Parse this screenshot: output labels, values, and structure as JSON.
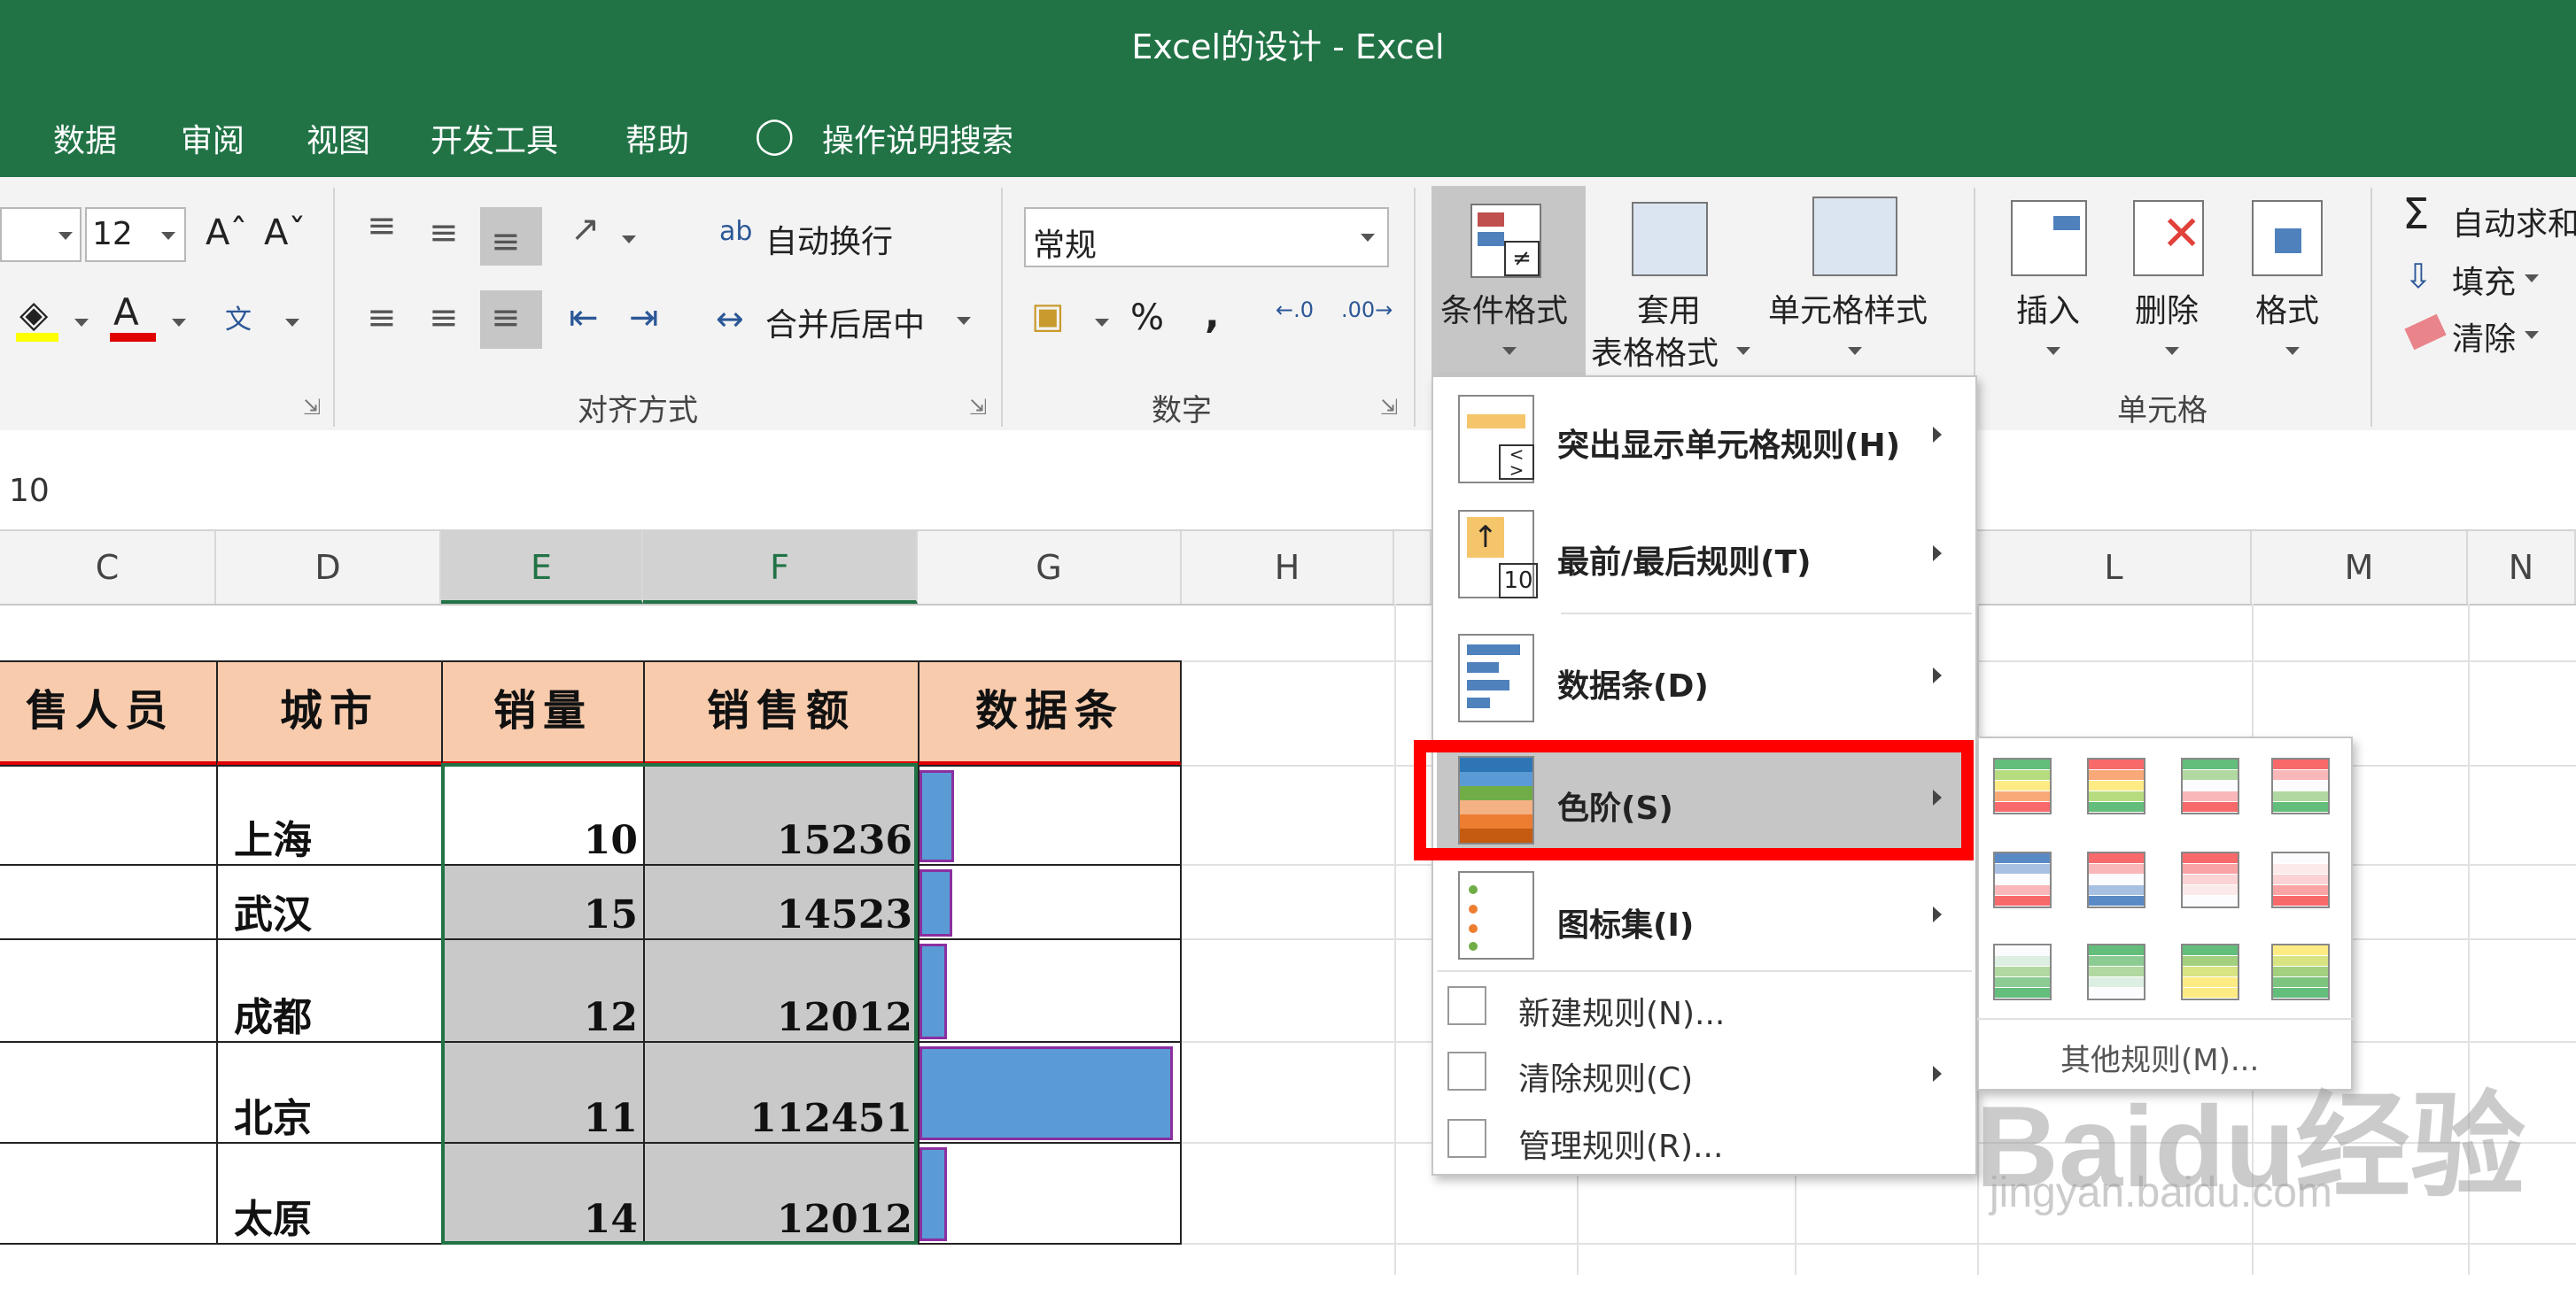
{
  "window": {
    "title": "Excel的设计  -  Excel",
    "theme_color": "#217346"
  },
  "menu": [
    "数据",
    "审阅",
    "视图",
    "开发工具",
    "帮助"
  ],
  "tell_me": "操作说明搜索",
  "ribbon": {
    "font_size": "12",
    "wrap_text": "自动换行",
    "merge_center": "合并后居中",
    "alignment_group": "对齐方式",
    "number_format": "常规",
    "number_group": "数字",
    "percent": "%",
    "comma": ",",
    "cond_format": "条件格式",
    "table_format_1": "套用",
    "table_format_2": "表格格式",
    "cell_styles": "单元格样式",
    "insert": "插入",
    "delete": "删除",
    "format": "格式",
    "cells_group": "单元格",
    "autosum": "自动求和",
    "fill": "填充",
    "clear": "清除",
    "font_color": "#e00000"
  },
  "formula_bar": {
    "value": "10"
  },
  "columns": [
    "C",
    "D",
    "E",
    "F",
    "G",
    "H",
    "L",
    "M",
    "N"
  ],
  "table": {
    "headers": [
      "售人员",
      "城市",
      "销量",
      "销售额",
      "数据条"
    ],
    "rows": [
      {
        "city": "上海",
        "qty": "10",
        "sales": "15236",
        "bar": 0.135
      },
      {
        "city": "武汉",
        "qty": "15",
        "sales": "14523",
        "bar": 0.129
      },
      {
        "city": "成都",
        "qty": "12",
        "sales": "12012",
        "bar": 0.107
      },
      {
        "city": "北京",
        "qty": "11",
        "sales": "112451",
        "bar": 1.0
      },
      {
        "city": "太原",
        "qty": "14",
        "sales": "12012",
        "bar": 0.107
      }
    ],
    "header_color": "#f8cbad",
    "bar_color": "#5b9bd5"
  },
  "dropdown": {
    "highlight": "突出显示单元格规则(H)",
    "topbottom": "最前/最后规则(T)",
    "databar": "数据条(D)",
    "colorscale": "色阶(S)",
    "iconset": "图标集(I)",
    "new_rule": "新建规则(N)...",
    "clear_rules": "清除规则(C)",
    "manage_rules": "管理规则(R)...",
    "icon_10": "10"
  },
  "submenu": {
    "more_rules": "其他规则(M)..."
  },
  "watermark": {
    "brand": "Baidu经验",
    "url": "jingyan.baidu.com"
  }
}
